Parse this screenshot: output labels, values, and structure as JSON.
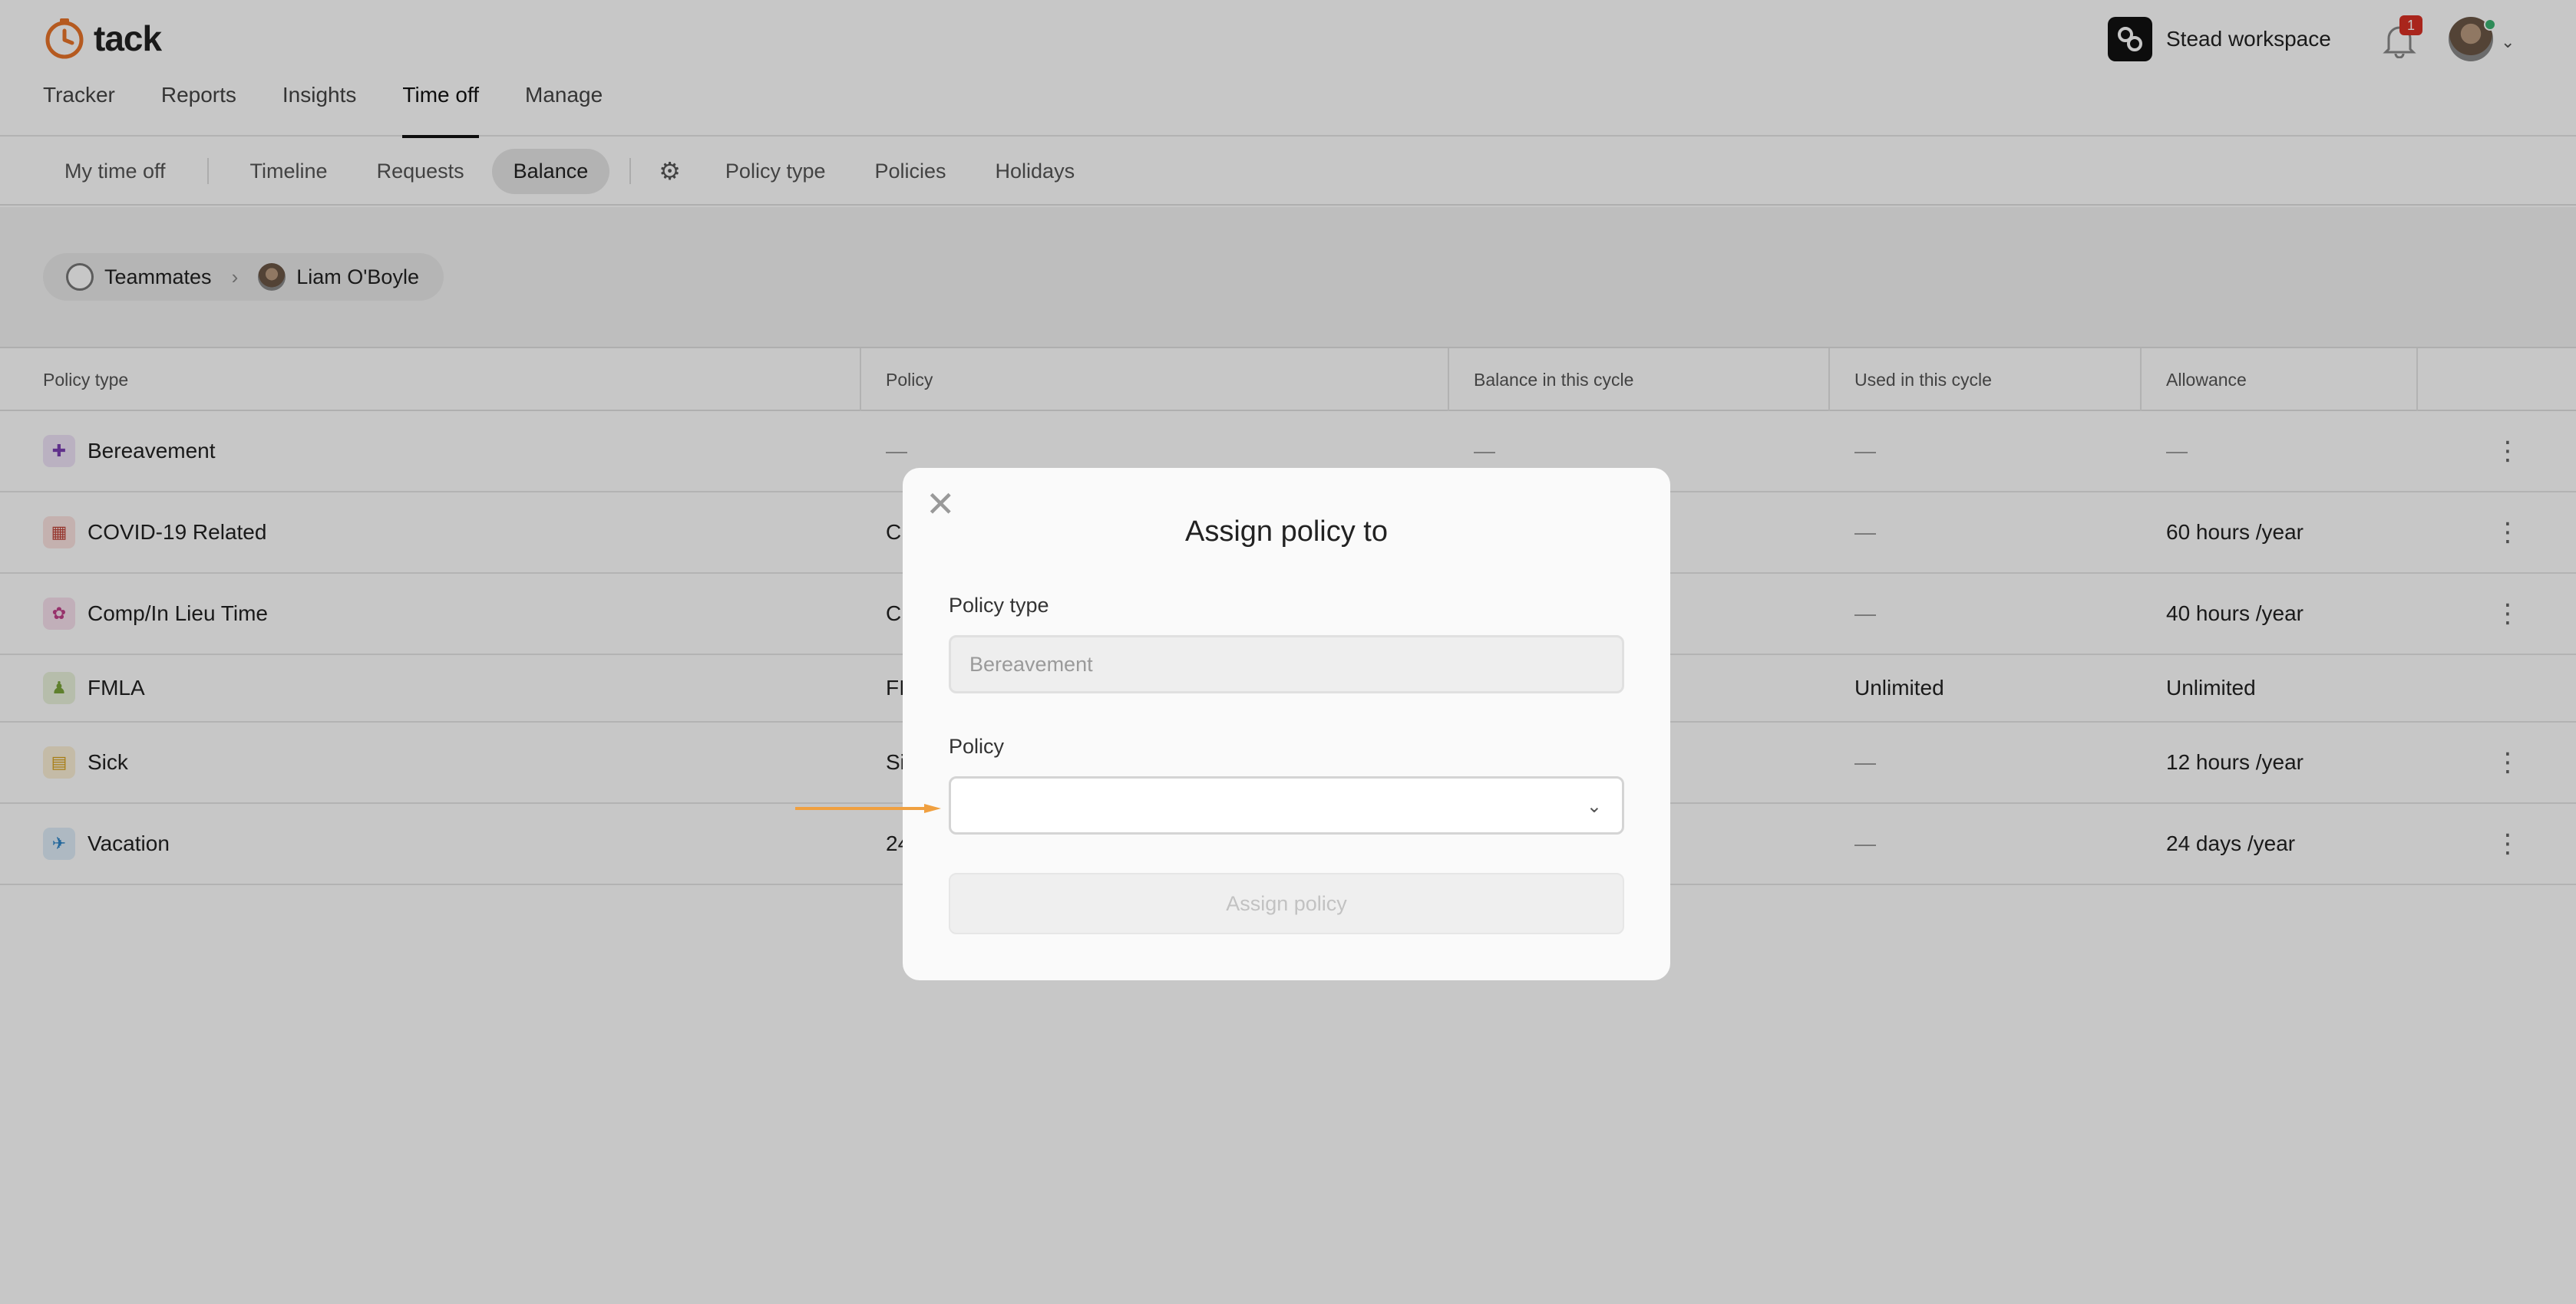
{
  "app": {
    "name": "tack"
  },
  "header": {
    "workspace": "Stead workspace",
    "notification_count": "1",
    "nav_tabs": [
      {
        "label": "Tracker"
      },
      {
        "label": "Reports"
      },
      {
        "label": "Insights"
      },
      {
        "label": "Time off",
        "active": true
      },
      {
        "label": "Manage"
      }
    ]
  },
  "subnav": {
    "my_time_off": "My time off",
    "timeline": "Timeline",
    "requests": "Requests",
    "balance": "Balance",
    "policy_type": "Policy type",
    "policies": "Policies",
    "holidays": "Holidays"
  },
  "breadcrumb": {
    "root": "Teammates",
    "current": "Liam O'Boyle"
  },
  "table": {
    "columns": [
      "Policy type",
      "Policy",
      "Balance in this cycle",
      "Used in this cycle",
      "Allowance"
    ],
    "rows": [
      {
        "type": "Bereavement",
        "policy": "—",
        "balance": "—",
        "used": "—",
        "allowance": "—",
        "icon": "plus-circle-icon",
        "color": "#7b3fb3",
        "bg": "#efe3f8"
      },
      {
        "type": "COVID-19 Related",
        "policy": "C",
        "balance": "",
        "used": "—",
        "allowance": "60 hours /year",
        "icon": "store-icon",
        "color": "#c0453a",
        "bg": "#fbe3e1"
      },
      {
        "type": "Comp/In Lieu Time",
        "policy": "C",
        "balance": "",
        "used": "—",
        "allowance": "40 hours /year",
        "icon": "film-reel-icon",
        "color": "#c2408a",
        "bg": "#f8e1ee"
      },
      {
        "type": "FMLA",
        "policy": "FI",
        "balance": "",
        "used": "Unlimited",
        "allowance": "Unlimited",
        "icon": "family-icon",
        "color": "#7aa43a",
        "bg": "#e9f2dc"
      },
      {
        "type": "Sick",
        "policy": "Si",
        "balance": "",
        "used": "—",
        "allowance": "12 hours /year",
        "icon": "clipboard-icon",
        "color": "#d7a21c",
        "bg": "#fbf0d6"
      },
      {
        "type": "Vacation",
        "policy": "24",
        "balance": "",
        "used": "—",
        "allowance": "24 days /year",
        "icon": "airplane-icon",
        "color": "#2f86c8",
        "bg": "#dfeef9"
      }
    ]
  },
  "modal": {
    "title": "Assign policy to",
    "policy_type_label": "Policy type",
    "policy_type_placeholder": "Bereavement",
    "policy_label": "Policy",
    "policy_value": "",
    "submit": "Assign policy"
  },
  "colors": {
    "accent": "#e8742a",
    "annotation_arrow": "#f0a040"
  }
}
